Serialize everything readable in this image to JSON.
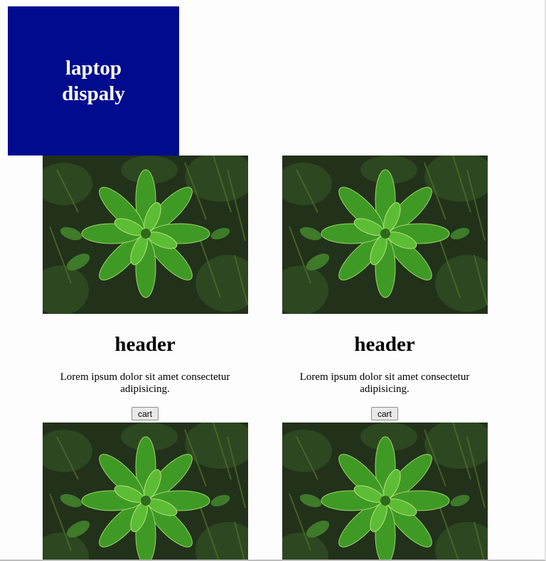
{
  "banner": {
    "title": "laptop dispaly",
    "background": "#000c8d"
  },
  "cards": [
    {
      "image": "plant-image",
      "header": "header",
      "text": "Lorem ipsum dolor sit amet consectetur adipisicing.",
      "button_label": "cart"
    },
    {
      "image": "plant-image",
      "header": "header",
      "text": "Lorem ipsum dolor sit amet consectetur adipisicing.",
      "button_label": "cart"
    },
    {
      "image": "plant-image"
    },
    {
      "image": "plant-image"
    }
  ],
  "colors": {
    "leaf": "#4fa52c",
    "foliage_dark": "#1f3318",
    "button_bg": "#e9e9e9"
  }
}
